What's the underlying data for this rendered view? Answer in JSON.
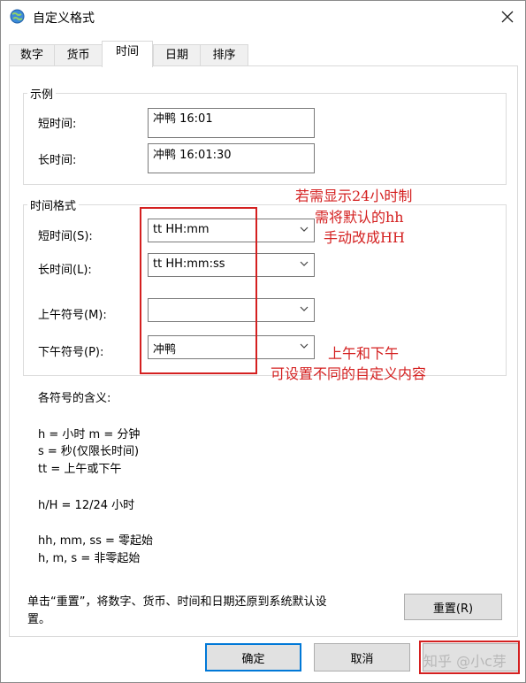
{
  "window": {
    "title": "自定义格式"
  },
  "tabs": [
    {
      "label": "数字"
    },
    {
      "label": "货币"
    },
    {
      "label": "时间"
    },
    {
      "label": "日期"
    },
    {
      "label": "排序"
    }
  ],
  "example": {
    "legend": "示例",
    "short_label": "短时间:",
    "short_value": "冲鸭 16:01",
    "long_label": "长时间:",
    "long_value": "冲鸭 16:01:30"
  },
  "format": {
    "legend": "时间格式",
    "short_label": "短时间(S):",
    "short_value": "tt HH:mm",
    "long_label": "长时间(L):",
    "long_value": "tt HH:mm:ss",
    "am_label": "上午符号(M):",
    "am_value": "",
    "pm_label": "下午符号(P):",
    "pm_value": "冲鸭"
  },
  "symbols": {
    "heading": "各符号的含义:",
    "line1": "h = 小时   m = 分钟",
    "line2": "s = 秒(仅限长时间)",
    "line3": "tt = 上午或下午",
    "line4": "h/H = 12/24 小时",
    "line5": "hh, mm, ss = 零起始",
    "line6": "h, m, s = 非零起始"
  },
  "reset": {
    "note_line1": "单击“重置”，将数字、货币、时间和日期还原到系统默认设",
    "note_line2": "置。",
    "button": "重置(R)"
  },
  "footer": {
    "ok": "确定",
    "cancel": "取消",
    "watermark": "知乎 @小c芽"
  },
  "annotations": {
    "top_line1": "若需显示24小时制",
    "top_line2": "需将默认的hh",
    "top_line3": "手动改成HH",
    "bottom_line1": "上午和下午",
    "bottom_line2": "可设置不同的自定义内容"
  },
  "colors": {
    "annotation": "#d42020",
    "focus": "#0078d7"
  }
}
